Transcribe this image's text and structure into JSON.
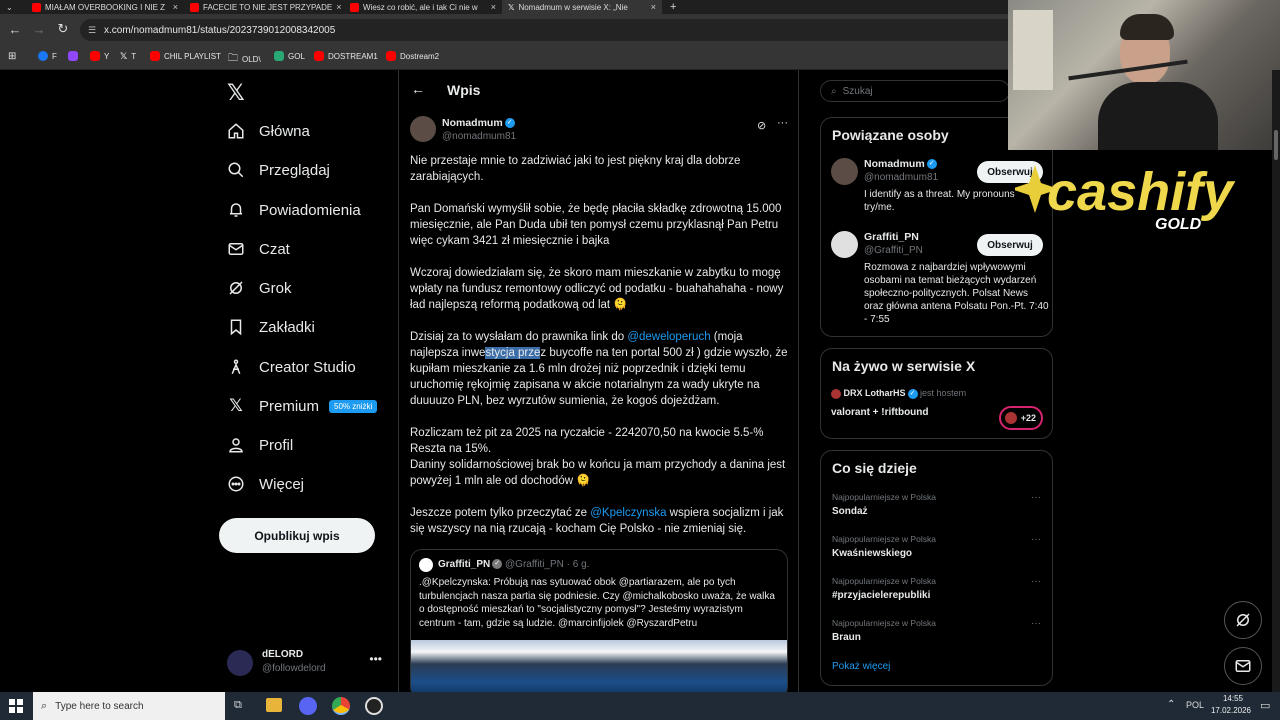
{
  "browser": {
    "tabs": [
      {
        "title": "MIAŁAM OVERBOOKING I NIE Z",
        "color": "#ff0000"
      },
      {
        "title": "FACECIE TO NIE JEST PRZYPADE",
        "color": "#ff0000"
      },
      {
        "title": "Wiesz co robić, ale i tak Ci nie w",
        "color": "#ff0000"
      },
      {
        "title": "Nomadmum w serwisie X: „Nie",
        "color": "#ffffff"
      }
    ],
    "url": "x.com/nomadmum81/status/2023739012008342005",
    "bookmarks": [
      {
        "label": "F",
        "color": "#1877f2"
      },
      {
        "label": "",
        "color": "#9146ff"
      },
      {
        "label": "Y",
        "color": "#ff0000"
      },
      {
        "label": "T",
        "color": "#000000"
      },
      {
        "label": "CHIL PLAYLIST",
        "color": "#ff0000"
      },
      {
        "label": "OLD\\",
        "color": "#888888"
      },
      {
        "label": "GOL",
        "color": "#2aa876"
      },
      {
        "label": "DOSTREAM1",
        "color": "#ff0000"
      },
      {
        "label": "Dostream2",
        "color": "#ff0000"
      }
    ]
  },
  "nav": {
    "items": [
      {
        "label": "Główna",
        "icon": "home-icon"
      },
      {
        "label": "Przeglądaj",
        "icon": "search-icon"
      },
      {
        "label": "Powiadomienia",
        "icon": "bell-icon"
      },
      {
        "label": "Czat",
        "icon": "mail-icon"
      },
      {
        "label": "Grok",
        "icon": "grok-icon"
      },
      {
        "label": "Zakładki",
        "icon": "bookmark-icon"
      },
      {
        "label": "Creator Studio",
        "icon": "creator-icon"
      },
      {
        "label": "Premium",
        "icon": "x-premium-icon"
      },
      {
        "label": "Profil",
        "icon": "person-icon"
      },
      {
        "label": "Więcej",
        "icon": "more-icon"
      }
    ],
    "premium_badge": "50% zniżki",
    "publish_label": "Opublikuj wpis",
    "account": {
      "name": "dELORD",
      "handle": "@followdelord"
    }
  },
  "post": {
    "header_title": "Wpis",
    "author_name": "Nomadmum",
    "author_handle": "@nomadmum81",
    "p1": "Nie przestaje mnie to zadziwiać jaki to jest piękny kraj dla dobrze zarabiających.",
    "p2": "Pan Domański wymyślił sobie, że będę płaciła składkę zdrowotną 15.000 miesięcznie, ale Pan Duda ubił ten pomysł czemu przyklasnął Pan Petru więc cykam 3421 zł miesięcznie i bajka",
    "p3": "Wczoraj dowiedziałam się, że skoro mam mieszkanie w zabytku to mogę wpłaty na fundusz remontowy odliczyć od podatku - buahahahaha - nowy ład najlepszą reformą podatkową od lat 🫠",
    "p4a": "Dzisiaj za to wysłałam do prawnika link do ",
    "p4_mention": "@deweloperuch",
    "p4b": " (moja najlepsza inwe",
    "p4_sel": "stycja prze",
    "p4c": "z buycoffe na ten portal 500 zł ) gdzie wyszło, że kupiłam mieszkanie za 1.6 mln drożej niż poprzednik i dzięki temu uruchomię rękojmię zapisana w akcie notarialnym za wady ukryte na duuuuzo PLN, bez wyrzutów sumienia, że kogoś dojeżdżam.",
    "p5a": "Rozliczam też pit za 2025 na ryczałcie - 2242070,50 na kwocie 5.5-% Reszta na 15%.",
    "p5b": "Daniny solidarnościowej brak bo w końcu ja mam przychody a danina jest powyżej 1 mln ale od dochodów 🫠",
    "p6a": "Jeszcze potem tylko przeczytać ze ",
    "p6_mention": "@Kpelczynska",
    "p6b": " wspiera socjalizm i jak się wszyscy na nią rzucają - kocham Cię Polsko - nie zmieniaj się.",
    "quote": {
      "author": "Graffiti_PN",
      "handle": "@Graffiti_PN",
      "time": "· 6 g.",
      "text": ".@Kpelczynska: Próbują nas sytuować obok @partiarazem, ale po tych turbulencjach nasza partia się podniesie. Czy @michalkobosko uważa, że walka o dostępność mieszkań to \"socjalistyczny pomysł\"? Jesteśmy wyrazistym centrum - tam, gdzie są ludzie. @marcinfijolek @RyszardPetru"
    }
  },
  "right": {
    "search_placeholder": "Szukaj",
    "related_title": "Powiązane osoby",
    "related": [
      {
        "name": "Nomadmum",
        "handle": "@nomadmum81",
        "bio": "I identify as a threat. My pronouns try/me.",
        "follow": "Obserwuj"
      },
      {
        "name": "Graffiti_PN",
        "handle": "@Graffiti_PN",
        "bio": "Rozmowa z najbardziej wpływowymi osobami na temat bieżących wydarzeń społeczno-politycznych. Polsat News oraz główna antena Polsatu Pon.-Pt. 7:40 - 7:55",
        "follow": "Obserwuj"
      }
    ],
    "live_title": "Na żywo w serwisie X",
    "live_host": "DRX LotharHS",
    "live_host_note": "jest hostem",
    "live_title_text": "valorant + !riftbound",
    "live_count": "+22",
    "trends_title": "Co się dzieje",
    "trends": [
      {
        "cat": "Najpopularniejsze w Polska",
        "name": "Sondaż"
      },
      {
        "cat": "Najpopularniejsze w Polska",
        "name": "Kwaśniewskiego"
      },
      {
        "cat": "Najpopularniejsze w Polska",
        "name": "#przyjacielerepubliki"
      },
      {
        "cat": "Najpopularniejsze w Polska",
        "name": "Braun"
      }
    ],
    "show_more": "Pokaż więcej"
  },
  "overlay": {
    "brand": "cashify",
    "brand_sub": "GOLD"
  },
  "taskbar": {
    "search_placeholder": "Type here to search",
    "lang": "POL",
    "time": "14:55",
    "date": "17.02.2026"
  }
}
